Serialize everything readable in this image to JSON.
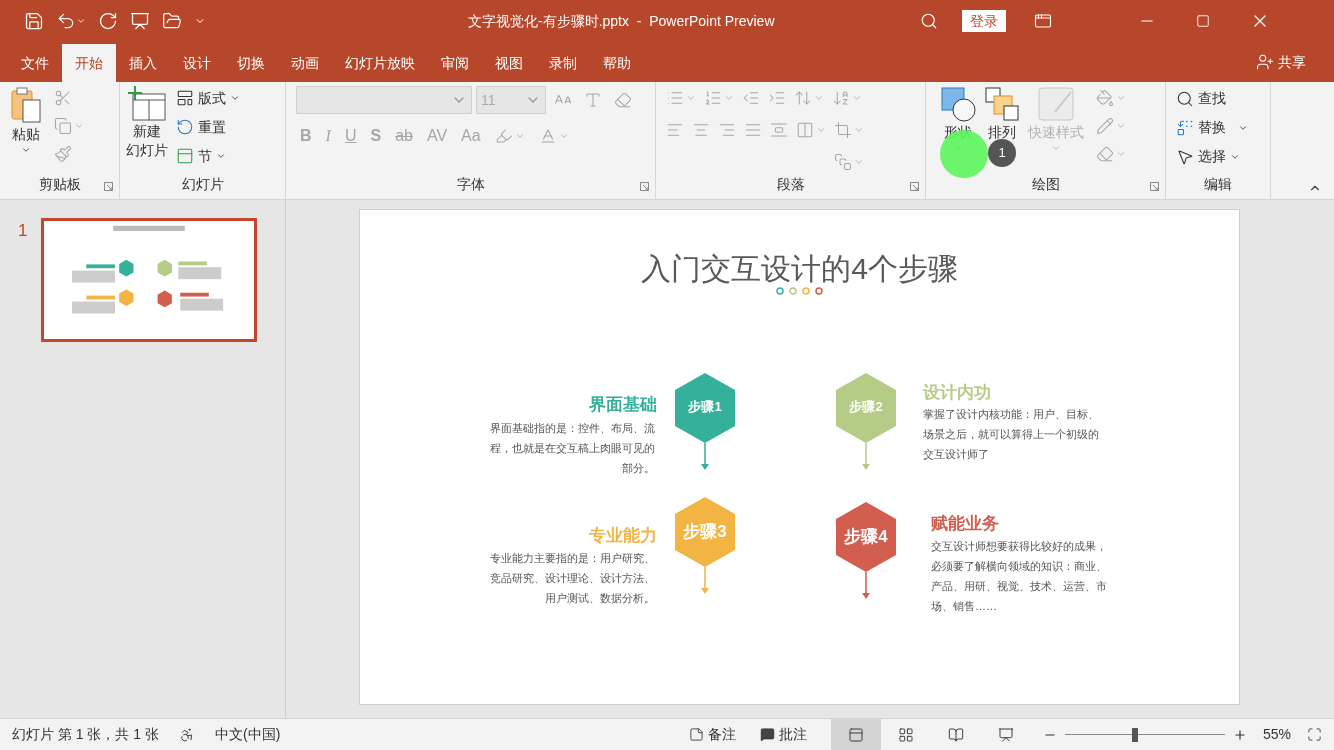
{
  "title_bar": {
    "title": "文字视觉化-有步骤时.pptx  -  PowerPoint Preview",
    "sign_in": "登录"
  },
  "tabs": [
    {
      "label": "文件",
      "selected": false
    },
    {
      "label": "开始",
      "selected": true
    },
    {
      "label": "插入",
      "selected": false
    },
    {
      "label": "设计",
      "selected": false
    },
    {
      "label": "切换",
      "selected": false
    },
    {
      "label": "动画",
      "selected": false
    },
    {
      "label": "幻灯片放映",
      "selected": false
    },
    {
      "label": "审阅",
      "selected": false
    },
    {
      "label": "视图",
      "selected": false
    },
    {
      "label": "录制",
      "selected": false
    },
    {
      "label": "帮助",
      "selected": false
    }
  ],
  "share": "共享",
  "clipboard": {
    "label": "剪贴板",
    "paste": "粘贴"
  },
  "slides_group": {
    "label": "幻灯片",
    "new_slide": [
      "新建",
      "幻灯片"
    ],
    "layout": "版式",
    "reset": "重置",
    "section": "节"
  },
  "font": {
    "label": "字体",
    "size": "11",
    "styles": [
      "B",
      "I",
      "U",
      "S",
      "ab",
      "AV",
      "Aa"
    ]
  },
  "paragraph": {
    "label": "段落"
  },
  "drawing": {
    "label": "绘图",
    "shapes": "形状",
    "arrange": "排列",
    "quick_styles": {
      "label": "快速样式",
      "disabled": true
    }
  },
  "editing": {
    "label": "编辑",
    "find": "查找",
    "replace": "替换",
    "select": "选择"
  },
  "click_badge": "1",
  "thumbnails": [
    {
      "number": "1",
      "selected": true
    }
  ],
  "slide": {
    "title": "入门交互设计的4个步骤",
    "steps": [
      {
        "badge": "步骤1",
        "title": "界面基础",
        "description": "界面基础指的是：控件、布局、流程，也就是在交互稿上肉眼可见的部分。",
        "color": "#35b19b"
      },
      {
        "badge": "步骤2",
        "title": "设计内功",
        "description": "掌握了设计内核功能：用户、目标、场景之后，就可以算得上一个初级的交互设计师了",
        "color": "#b4cc86"
      },
      {
        "badge": "步骤3",
        "title": "专业能力",
        "description": "专业能力主要指的是：用户研究、竞品研究、设计理论、设计方法、用户测试、数据分析。",
        "color": "#f2b442"
      },
      {
        "badge": "步骤4",
        "title": "赋能业务",
        "description": "交互设计师想要获得比较好的成果，必须要了解横向领域的知识：商业、产品、用研、视觉、技术、运营、市场、销售……",
        "color": "#d15e4f"
      }
    ]
  },
  "status_bar": {
    "slide_info": "幻灯片 第 1 张，共 1 张",
    "language": "中文(中国)",
    "notes": "备注",
    "comments": "批注",
    "views": [
      {
        "kind": "normal",
        "selected": true
      },
      {
        "kind": "sorter",
        "selected": false
      },
      {
        "kind": "reading",
        "selected": false
      },
      {
        "kind": "slideshow",
        "selected": false
      }
    ],
    "zoom": {
      "level": 0.44,
      "reading": "55%"
    }
  }
}
